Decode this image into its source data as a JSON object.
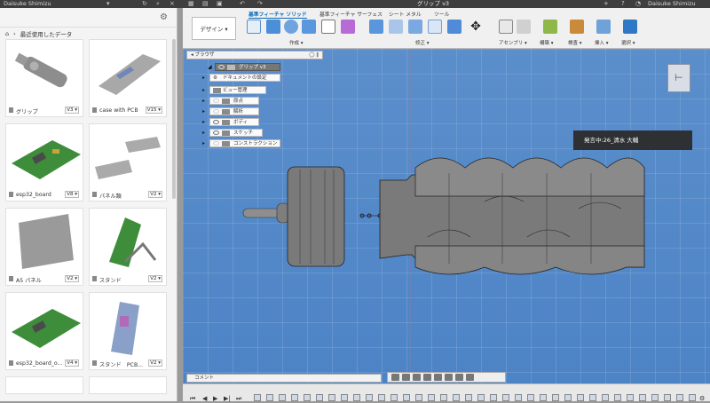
{
  "titlebar": {
    "user": "Daisuke Shimizu",
    "document": "グリップ v3",
    "right_user": "Daisuke Shimizu"
  },
  "data_panel": {
    "breadcrumb": "最近使用したデータ",
    "items": [
      {
        "label": "グリップ",
        "version": "V3 ▾"
      },
      {
        "label": "case with PCB",
        "version": "V15 ▾"
      },
      {
        "label": "esp32_board",
        "version": "V8 ▾"
      },
      {
        "label": "パネル類",
        "version": "V2 ▾"
      },
      {
        "label": "A5 パネル",
        "version": "V2 ▾"
      },
      {
        "label": "スタンド",
        "version": "V2 ▾"
      },
      {
        "label": "esp32_board_o...",
        "version": "V4 ▾"
      },
      {
        "label": "スタンド　PCB...",
        "version": "V2 ▾"
      }
    ]
  },
  "toolbar": {
    "design_button": "デザイン ▾",
    "tabs": [
      "基準フィーチャ ソリッド",
      "基準フィーチャ サーフェス",
      "シート メタル",
      "ツール"
    ],
    "groups": [
      "作成 ▾",
      "修正 ▾",
      "アセンブリ ▾",
      "構築 ▾",
      "検査 ▾",
      "挿入 ▾",
      "選択 ▾"
    ]
  },
  "browser": {
    "title": "ブラウザ",
    "root": "グリップ v3",
    "nodes": [
      "ドキュメントの設定",
      "ビュー管理",
      "原点",
      "解析",
      "ボディ",
      "スケッチ",
      "コンストラクション"
    ]
  },
  "viewport": {
    "speaker": "発言中:26_清水 大輔",
    "comment": "コメント",
    "background_color": "#4f86c8"
  }
}
